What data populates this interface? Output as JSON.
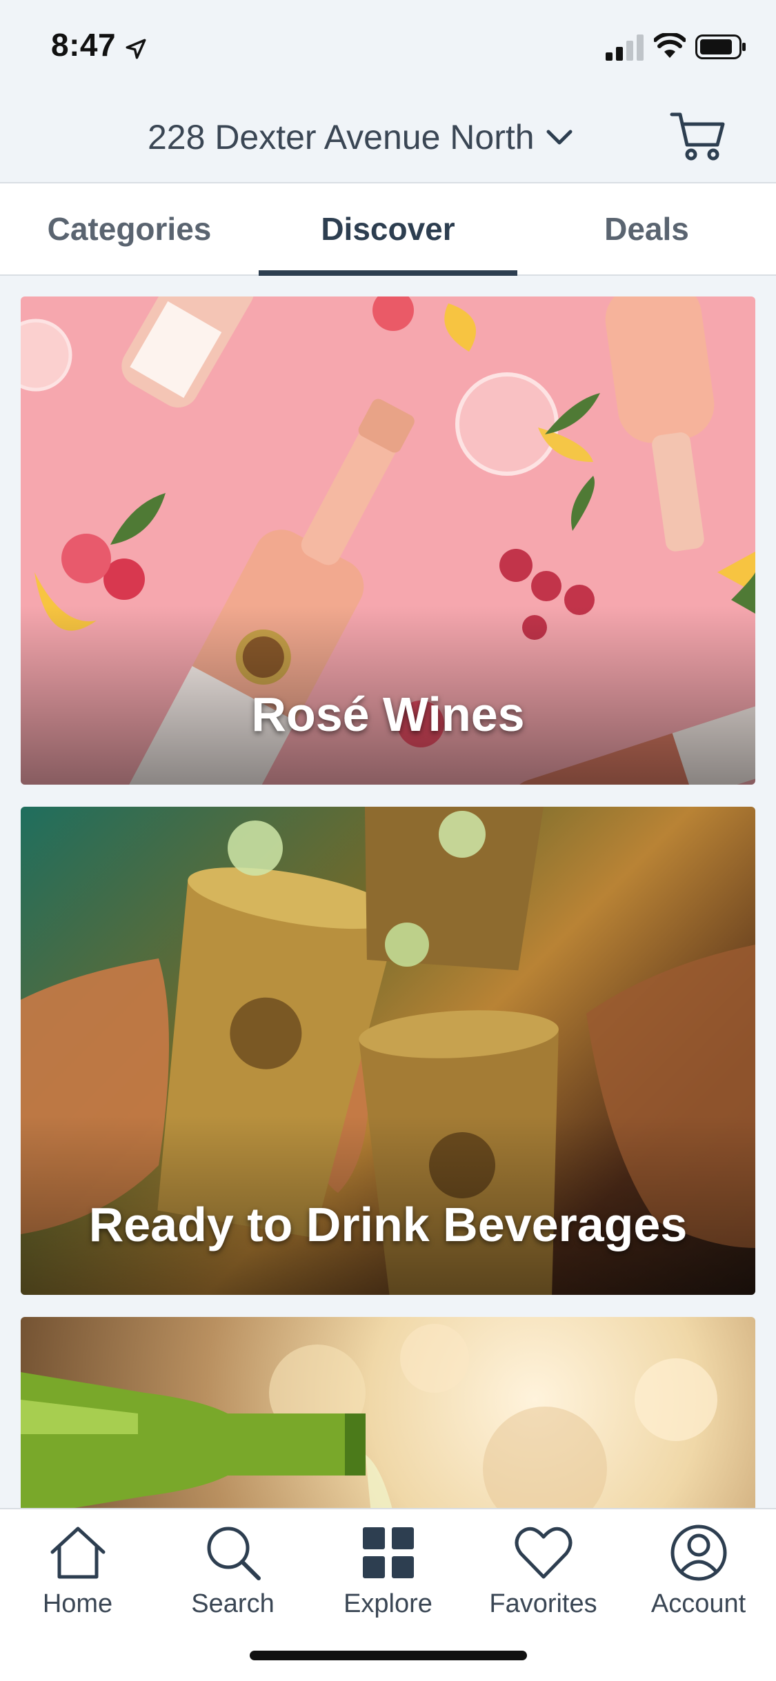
{
  "status_bar": {
    "time": "8:47"
  },
  "header": {
    "address": "228 Dexter Avenue North"
  },
  "tabs": [
    {
      "label": "Categories",
      "active": false
    },
    {
      "label": "Discover",
      "active": true
    },
    {
      "label": "Deals",
      "active": false
    }
  ],
  "feed": {
    "cards": [
      {
        "title": "Rosé Wines"
      },
      {
        "title": "Ready to Drink Beverages"
      },
      {
        "title": ""
      }
    ]
  },
  "bottom_nav": {
    "items": [
      {
        "label": "Home",
        "icon": "home-icon"
      },
      {
        "label": "Search",
        "icon": "search-icon"
      },
      {
        "label": "Explore",
        "icon": "grid-icon"
      },
      {
        "label": "Favorites",
        "icon": "heart-icon"
      },
      {
        "label": "Account",
        "icon": "user-icon"
      }
    ]
  },
  "colors": {
    "primary": "#2d3e50",
    "header_background": "#f0f4f8",
    "divider": "#d9dee3"
  }
}
